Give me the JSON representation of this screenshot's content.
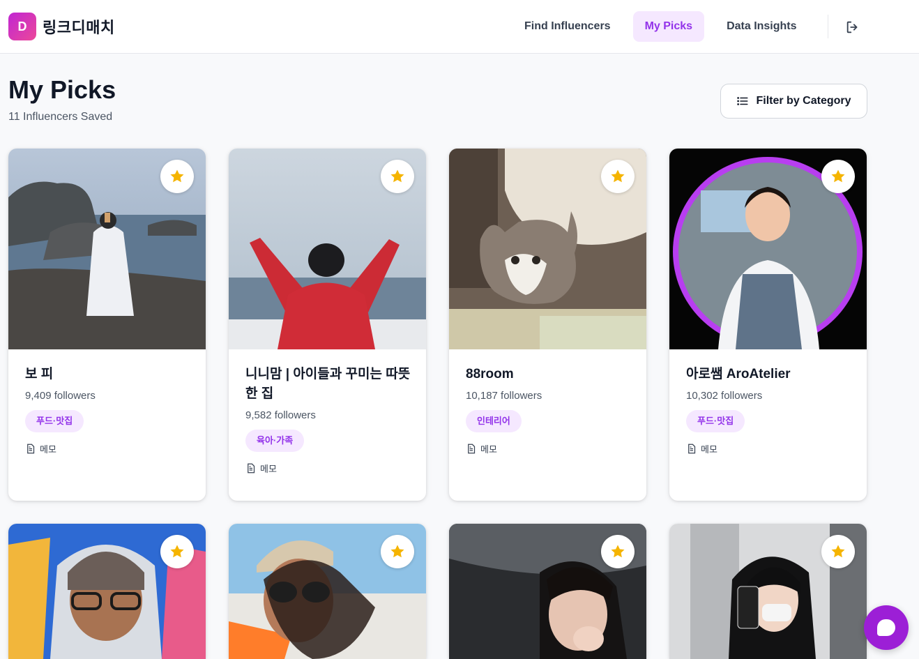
{
  "app": {
    "logo_letter": "D",
    "name": "링크디매치"
  },
  "nav": {
    "items": [
      {
        "label": "Find Influencers",
        "active": false
      },
      {
        "label": "My Picks",
        "active": true
      },
      {
        "label": "Data Insights",
        "active": false
      }
    ],
    "logout_icon": "logout-icon"
  },
  "page": {
    "title": "My Picks",
    "subtitle": "11 Influencers Saved",
    "filter_label": "Filter by Category"
  },
  "cards": [
    {
      "name": "보 피",
      "followers": "9,409 followers",
      "tag": "푸드·맛집",
      "memo": "메모"
    },
    {
      "name": "니니맘 | 아이들과 꾸미는 따뜻한 집",
      "followers": "9,582 followers",
      "tag": "육아·가족",
      "memo": "메모"
    },
    {
      "name": "88room",
      "followers": "10,187 followers",
      "tag": "인테리어",
      "memo": "메모"
    },
    {
      "name": "아로쌤 AroAtelier",
      "followers": "10,302 followers",
      "tag": "푸드·맛집",
      "memo": "메모"
    },
    {
      "name": "",
      "followers": "",
      "tag": "",
      "memo": ""
    },
    {
      "name": "",
      "followers": "",
      "tag": "",
      "memo": ""
    },
    {
      "name": "",
      "followers": "",
      "tag": "",
      "memo": ""
    },
    {
      "name": "",
      "followers": "",
      "tag": "",
      "memo": ""
    }
  ],
  "colors": {
    "accent": "#9333ea",
    "accent_bg": "#f5e8ff",
    "star": "#f5b400",
    "fab": "#9c1fd6"
  }
}
